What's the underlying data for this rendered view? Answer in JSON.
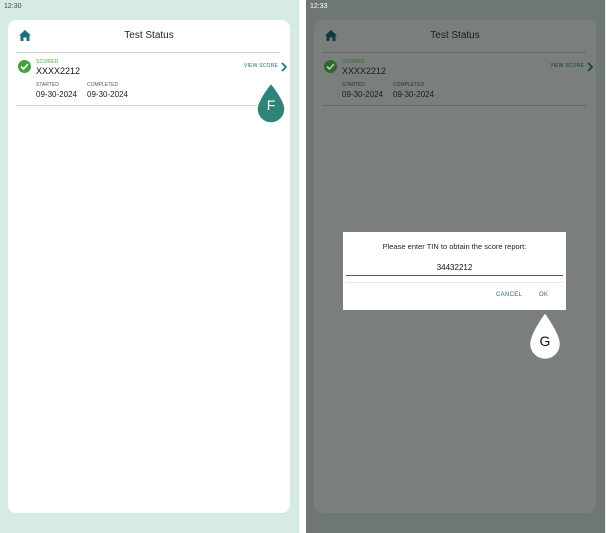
{
  "left": {
    "time": "12:30",
    "header": {
      "title": "Test Status"
    },
    "test": {
      "status": "SCORED",
      "code": "XXXX2212",
      "started_label": "STARTED",
      "started": "09-30-2024",
      "completed_label": "COMPLETED",
      "completed": "09-30-2024",
      "view_label": "VIEW SCORE"
    },
    "marker": "F"
  },
  "right": {
    "time": "12:33",
    "header": {
      "title": "Test Status"
    },
    "test": {
      "status": "SCORED",
      "code": "XXXX2212",
      "started_label": "STARTED",
      "started": "09-30-2024",
      "completed_label": "COMPLETED",
      "completed": "09-30-2024",
      "view_label": "VIEW SCORE"
    },
    "dialog": {
      "message": "Please enter TIN to obtain the score report:",
      "value": "34432212",
      "cancel_label": "CANCEL",
      "ok_label": "OK"
    },
    "marker": "G"
  },
  "colors": {
    "accent": "#1f6e78",
    "success": "#3fa43f",
    "background": "#d6ebe6",
    "scrim": "#6f7775",
    "marker_fill": "#2e8478"
  },
  "icons": [
    "home-icon",
    "check-circle-icon",
    "chevron-right-icon",
    "teardrop-marker"
  ]
}
